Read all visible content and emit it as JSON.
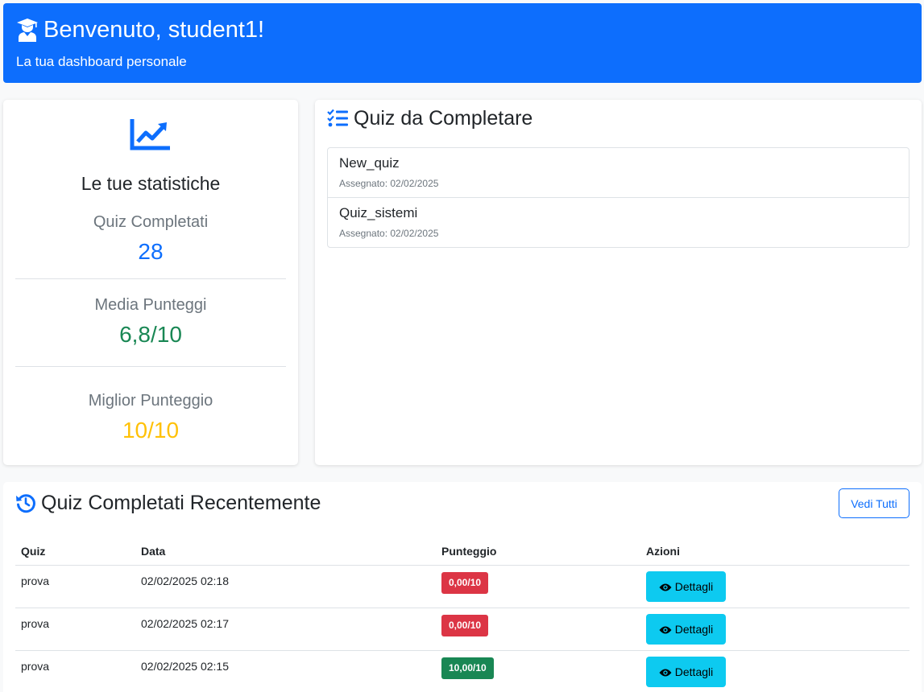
{
  "header": {
    "title": "Benvenuto, student1!",
    "subtitle": "La tua dashboard personale",
    "icon": "graduate-icon"
  },
  "stats": {
    "icon": "chart-line-icon",
    "title": "Le tue statistiche",
    "items": [
      {
        "label": "Quiz Completati",
        "value": "28",
        "color": "#0d6efd"
      },
      {
        "label": "Media Punteggi",
        "value": "6,8/10",
        "color": "#198754"
      },
      {
        "label": "Miglior Punteggio",
        "value": "10/10",
        "color": "#ffc107"
      }
    ]
  },
  "pending": {
    "icon": "tasks-icon",
    "title": "Quiz da Completare",
    "items": [
      {
        "name": "New_quiz",
        "assigned": "Assegnato: 02/02/2025"
      },
      {
        "name": "Quiz_sistemi",
        "assigned": "Assegnato: 02/02/2025"
      }
    ]
  },
  "recent": {
    "icon": "history-icon",
    "title": "Quiz Completati Recentemente",
    "view_all": "Vedi Tutti",
    "columns": [
      "Quiz",
      "Data",
      "Punteggio",
      "Azioni"
    ],
    "rows": [
      {
        "quiz": "prova",
        "date": "02/02/2025 02:18",
        "score": "0,00/10",
        "status": "fail",
        "action": "Dettagli"
      },
      {
        "quiz": "prova",
        "date": "02/02/2025 02:17",
        "score": "0,00/10",
        "status": "fail",
        "action": "Dettagli"
      },
      {
        "quiz": "prova",
        "date": "02/02/2025 02:15",
        "score": "10,00/10",
        "status": "pass",
        "action": "Dettagli"
      }
    ]
  },
  "colors": {
    "primary": "#0d6efd",
    "success": "#198754",
    "danger": "#dc3545",
    "warning": "#ffc107",
    "info": "#0dcaf0"
  }
}
